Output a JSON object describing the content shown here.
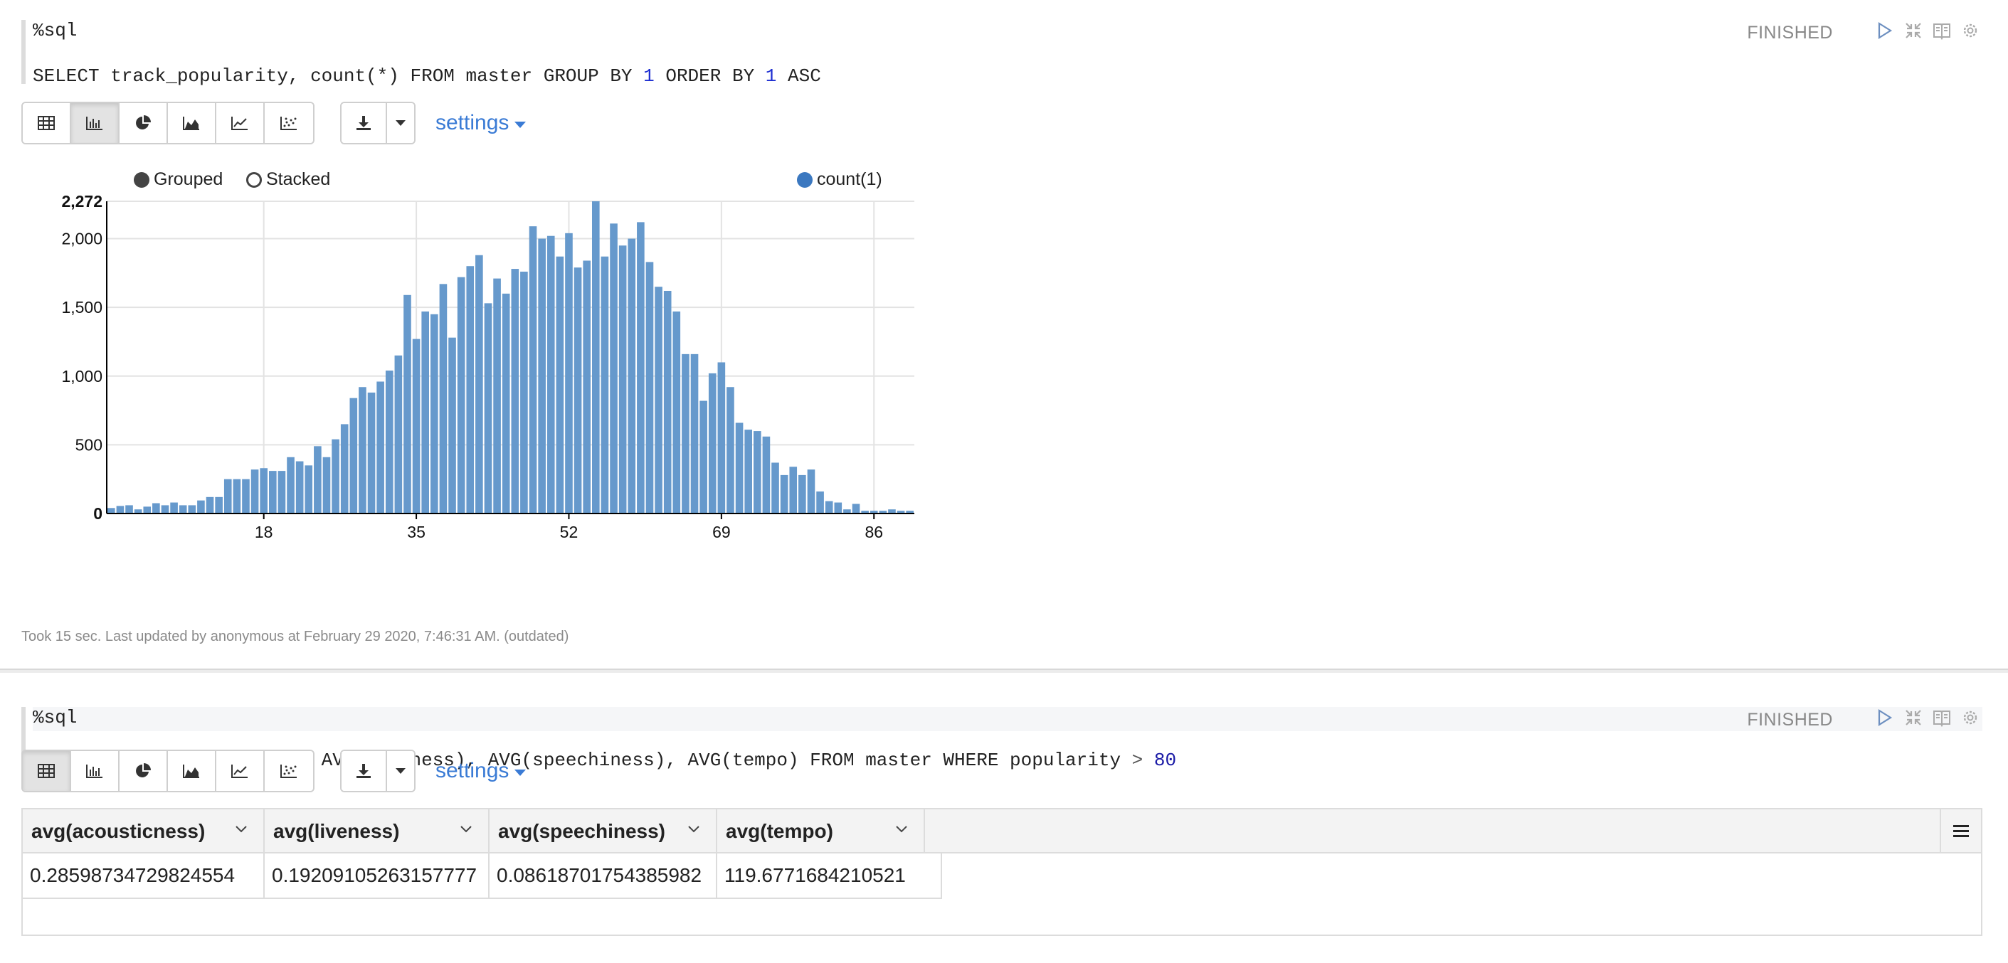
{
  "paragraphs": [
    {
      "interpreter": "%sql",
      "query_parts": [
        "SELECT track_popularity, count(*) FROM master GROUP BY ",
        "1",
        " ORDER BY ",
        "1",
        " ASC"
      ],
      "status": "FINISHED",
      "settings_label": "settings",
      "footer": "Took 15 sec. Last updated by anonymous at February 29 2020, 7:46:31 AM. (outdated)"
    },
    {
      "interpreter": "%sql",
      "query_parts": [
        "SELECT AVG(acousticness), AVG(liveness), AVG(speechiness), AVG(tempo) FROM master WHERE popularity ",
        ">",
        " ",
        "80"
      ],
      "status": "FINISHED",
      "settings_label": "settings"
    }
  ],
  "chart_legend": {
    "grouped": "Grouped",
    "stacked": "Stacked",
    "series": "count(1)"
  },
  "colors": {
    "bar": "#6699cc",
    "accent": "#3a7bd5",
    "series_dot": "#3b78c0"
  },
  "icons": [
    "table-icon",
    "bar-chart-icon",
    "pie-chart-icon",
    "area-chart-icon",
    "line-chart-icon",
    "scatter-chart-icon",
    "download-icon",
    "caret-down-icon",
    "run-icon",
    "collapse-icon",
    "book-icon",
    "gear-icon",
    "menu-icon",
    "chevron-down-icon"
  ],
  "chart_data": {
    "type": "bar",
    "x_start": 1,
    "y_ticks": [
      "0",
      "500",
      "1,000",
      "1,500",
      "2,000",
      "2,272"
    ],
    "y_tick_values": [
      0,
      500,
      1000,
      1500,
      2000,
      2272
    ],
    "x_ticks": [
      "18",
      "35",
      "52",
      "69",
      "86"
    ],
    "x_tick_values": [
      18,
      35,
      52,
      69,
      86
    ],
    "ylim": [
      0,
      2272
    ],
    "grid": true,
    "legend_placement": "top",
    "series": [
      {
        "name": "count(1)",
        "values": [
          40,
          55,
          60,
          30,
          50,
          75,
          60,
          80,
          60,
          60,
          95,
          120,
          120,
          250,
          250,
          250,
          320,
          330,
          310,
          310,
          410,
          380,
          350,
          490,
          410,
          540,
          650,
          840,
          920,
          880,
          960,
          1040,
          1150,
          1590,
          1270,
          1470,
          1450,
          1670,
          1280,
          1720,
          1800,
          1880,
          1530,
          1710,
          1600,
          1780,
          1760,
          2090,
          2000,
          2020,
          1870,
          2040,
          1790,
          1840,
          2272,
          1870,
          2110,
          1950,
          2000,
          2120,
          1830,
          1650,
          1620,
          1470,
          1160,
          1160,
          820,
          1020,
          1100,
          920,
          660,
          610,
          600,
          560,
          370,
          280,
          340,
          280,
          320,
          160,
          90,
          80,
          30,
          70,
          20,
          20,
          20,
          30,
          20,
          20
        ]
      }
    ]
  },
  "result_table": {
    "columns": [
      "avg(acousticness)",
      "avg(liveness)",
      "avg(speechiness)",
      "avg(tempo)"
    ],
    "rows": [
      [
        "0.28598734729824554",
        "0.19209105263157777",
        "0.08618701754385982",
        "119.6771684210521"
      ]
    ]
  }
}
